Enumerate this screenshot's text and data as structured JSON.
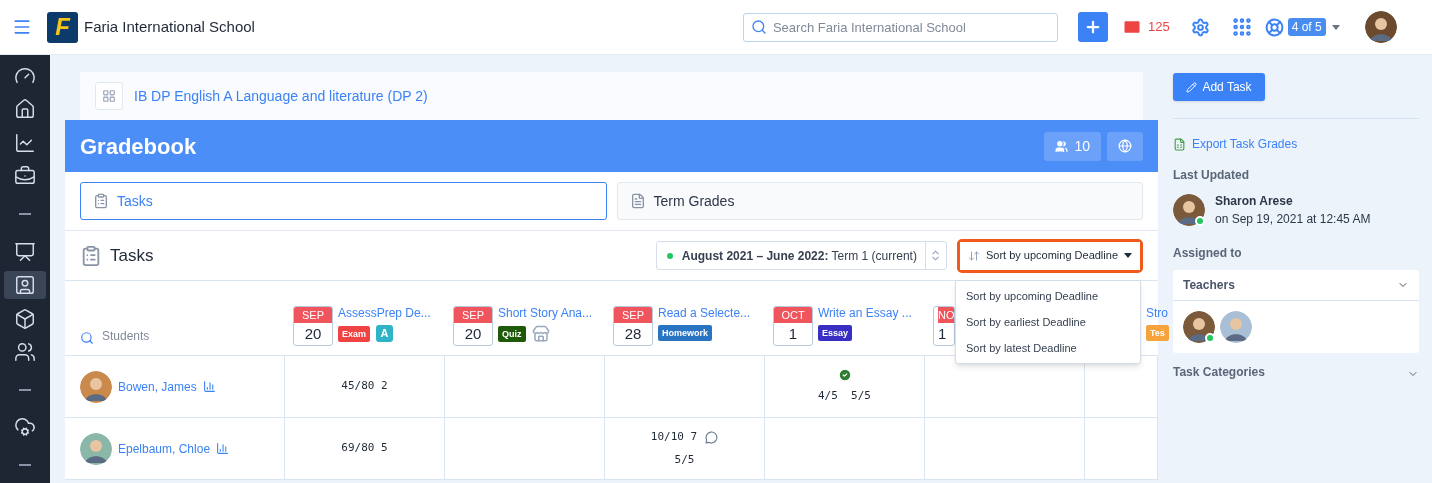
{
  "topbar": {
    "logo_letter": "F",
    "school": "Faria International School",
    "search": {
      "placeholder": "Search Faria International School"
    },
    "messages_count": "125",
    "help_badge": "4 of 5"
  },
  "sidebar": {
    "items": [
      {
        "kind": "gauge",
        "selected": false
      },
      {
        "kind": "home",
        "selected": false
      },
      {
        "kind": "chart",
        "selected": false
      },
      {
        "kind": "briefcase",
        "selected": false
      },
      {
        "kind": "separator"
      },
      {
        "kind": "board",
        "selected": false
      },
      {
        "kind": "teacher",
        "selected": true
      },
      {
        "kind": "cube",
        "selected": false
      },
      {
        "kind": "users",
        "selected": false
      },
      {
        "kind": "separator"
      },
      {
        "kind": "cloud",
        "selected": false
      },
      {
        "kind": "separator"
      }
    ]
  },
  "breadcrumb": {
    "title": "IB DP English A Language and literature (DP 2)"
  },
  "gradebook": {
    "title": "Gradebook",
    "student_count": "10",
    "tabs": [
      {
        "label": "Tasks",
        "selected": true
      },
      {
        "label": "Term Grades",
        "selected": false
      }
    ],
    "section_title": "Tasks",
    "term": "**August 2021 – June 2022:** Term 1 (current)",
    "sort": {
      "label": "Sort by upcoming Deadline",
      "open": true,
      "options": [
        "Sort by upcoming Deadline",
        "Sort by earliest Deadline",
        "Sort by latest Deadline"
      ]
    },
    "students_search": {
      "placeholder": "Students"
    },
    "tasks": [
      {
        "month": "SEP",
        "day": "20",
        "title": "AssessPrep De...",
        "tag": {
          "label": "Exam",
          "color": "#ef4444"
        },
        "addon": {
          "kind": "app_badge",
          "text": "A"
        }
      },
      {
        "month": "SEP",
        "day": "20",
        "title": "Short Story Ana...",
        "tag": {
          "label": "Quiz",
          "color": "#1f5a0b"
        },
        "addon": {
          "kind": "store"
        }
      },
      {
        "month": "SEP",
        "day": "28",
        "title": "Read a Selecte...",
        "tag": {
          "label": "Homework",
          "color": "#2a74c4"
        }
      },
      {
        "month": "OCT",
        "day": "1",
        "title": "Write an Essay ...",
        "tag": {
          "label": "Essay",
          "color": "#3a2fc4"
        }
      },
      {
        "month": "NO",
        "day": "1"
      },
      {
        "title": "Stro",
        "tag": {
          "label": "Tes",
          "color": "#f5a33a"
        }
      }
    ],
    "rows": [
      {
        "name": "Bowen, James",
        "cells": [
          {
            "kind": "score",
            "lines": [
              "45/80 2"
            ],
            "completed": false,
            "comment": false
          },
          {
            "kind": "empty"
          },
          {
            "kind": "empty"
          },
          {
            "kind": "score",
            "lines": [
              "4/5  5/5"
            ],
            "completed": true,
            "comment": false
          },
          {
            "kind": "empty"
          },
          {
            "kind": "empty"
          }
        ]
      },
      {
        "name": "Epelbaum, Chloe",
        "cells": [
          {
            "kind": "score",
            "lines": [
              "69/80 5"
            ],
            "completed": false,
            "comment": false
          },
          {
            "kind": "empty"
          },
          {
            "kind": "score",
            "lines": [
              "10/10 7",
              "5/5"
            ],
            "completed": false,
            "comment": true
          },
          {
            "kind": "empty"
          },
          {
            "kind": "empty"
          },
          {
            "kind": "empty"
          }
        ]
      }
    ]
  },
  "panel": {
    "add_task": "Add Task",
    "export": "Export Task Grades",
    "last_updated": {
      "label": "Last Updated",
      "name": "Sharon Arese",
      "time": "on Sep 19, 2021 at 12:45 AM",
      "online": true
    },
    "assigned": {
      "label": "Assigned to",
      "group": "Teachers",
      "expanded": true,
      "teachers": [
        {
          "online": true
        },
        {
          "online": false
        }
      ]
    },
    "categories": {
      "label": "Task Categories",
      "expanded": false
    }
  }
}
